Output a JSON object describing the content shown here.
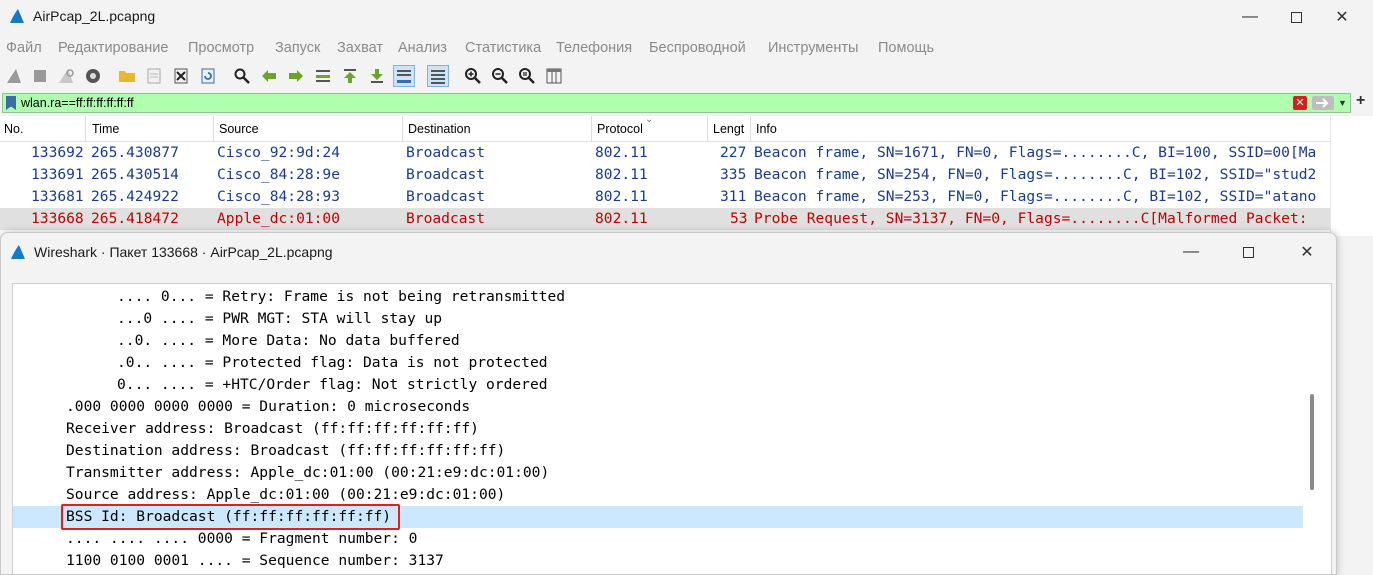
{
  "window": {
    "title": "AirPcap_2L.pcapng"
  },
  "menu": [
    "Файл",
    "Редактирование",
    "Просмотр",
    "Запуск",
    "Захват",
    "Анализ",
    "Статистика",
    "Телефония",
    "Беспроводной",
    "Инструменты",
    "Помощь"
  ],
  "toolbar": {
    "icons": [
      "start-capture-icon",
      "stop-capture-icon",
      "restart-capture-icon",
      "capture-options-icon",
      "open-file-icon",
      "save-file-icon",
      "close-file-icon",
      "reload-file-icon",
      "find-packet-icon",
      "go-back-icon",
      "go-forward-icon",
      "go-to-packet-icon",
      "first-packet-icon",
      "last-packet-icon",
      "autoscroll-icon",
      "colorize-icon",
      "zoom-in-icon",
      "zoom-out-icon",
      "normal-size-icon",
      "resize-columns-icon"
    ]
  },
  "filter": {
    "value": "wlan.ra==ff:ff:ff:ff:ff:ff"
  },
  "packet_list": {
    "columns": [
      "No.",
      "Time",
      "Source",
      "Destination",
      "Protocol",
      "Lengt",
      "Info"
    ],
    "rows": [
      {
        "no": "133692",
        "time": "265.430877",
        "source": "Cisco_92:9d:24",
        "destination": "Broadcast",
        "protocol": "802.11",
        "length": "227",
        "info": "Beacon frame, SN=1671, FN=0, Flags=........C, BI=100, SSID=00[Ma"
      },
      {
        "no": "133691",
        "time": "265.430514",
        "source": "Cisco_84:28:9e",
        "destination": "Broadcast",
        "protocol": "802.11",
        "length": "335",
        "info": "Beacon frame, SN=254, FN=0, Flags=........C, BI=102, SSID=\"stud2"
      },
      {
        "no": "133681",
        "time": "265.424922",
        "source": "Cisco_84:28:93",
        "destination": "Broadcast",
        "protocol": "802.11",
        "length": "311",
        "info": "Beacon frame, SN=253, FN=0, Flags=........C, BI=102, SSID=\"atano"
      },
      {
        "no": "133668",
        "time": "265.418472",
        "source": "Apple_dc:01:00",
        "destination": "Broadcast",
        "protocol": "802.11",
        "length": "53",
        "info": "Probe Request, SN=3137, FN=0, Flags=........C[Malformed Packet:"
      }
    ]
  },
  "detail_window": {
    "title": "Wireshark · Пакет 133668 · AirPcap_2L.pcapng",
    "lines": [
      {
        "indent": 2,
        "text": ".... 0... = Retry: Frame is not being retransmitted"
      },
      {
        "indent": 2,
        "text": "...0 .... = PWR MGT: STA will stay up"
      },
      {
        "indent": 2,
        "text": "..0. .... = More Data: No data buffered"
      },
      {
        "indent": 2,
        "text": ".0.. .... = Protected flag: Data is not protected"
      },
      {
        "indent": 2,
        "text": "0... .... = +HTC/Order flag: Not strictly ordered"
      },
      {
        "indent": 1,
        "text": ".000 0000 0000 0000 = Duration: 0 microseconds"
      },
      {
        "indent": 1,
        "text": "Receiver address: Broadcast (ff:ff:ff:ff:ff:ff)"
      },
      {
        "indent": 1,
        "text": "Destination address: Broadcast (ff:ff:ff:ff:ff:ff)"
      },
      {
        "indent": 1,
        "text": "Transmitter address: Apple_dc:01:00 (00:21:e9:dc:01:00)"
      },
      {
        "indent": 1,
        "text": "Source address: Apple_dc:01:00 (00:21:e9:dc:01:00)"
      },
      {
        "indent": 1,
        "text": "BSS Id: Broadcast (ff:ff:ff:ff:ff:ff)"
      },
      {
        "indent": 1,
        "text": ".... .... .... 0000 = Fragment number: 0"
      },
      {
        "indent": 1,
        "text": "1100 0100 0001 .... = Sequence number: 3137"
      }
    ]
  },
  "colors": {
    "filter_ok": "#afffaf",
    "selected_row_text": "#c00000",
    "tree_selection": "#cce8ff",
    "highlight_box": "#e02020"
  }
}
